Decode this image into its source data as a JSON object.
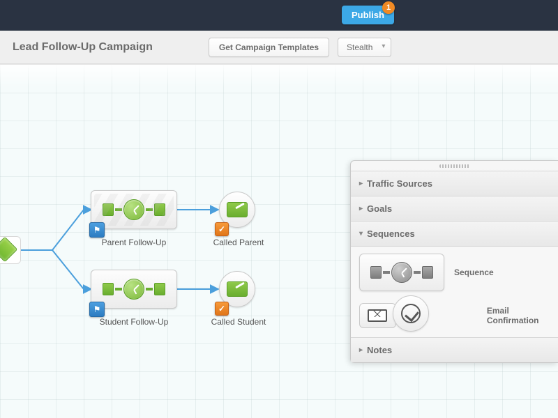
{
  "topbar": {
    "publish_label": "Publish",
    "publish_badge": "1"
  },
  "header": {
    "title": "Lead Follow-Up Campaign",
    "get_templates_label": "Get Campaign Templates",
    "mode_dropdown": "Stealth"
  },
  "canvas": {
    "nodes": {
      "seq1": {
        "label": "Parent Follow-Up"
      },
      "seq2": {
        "label": "Student Follow-Up"
      },
      "goal1": {
        "label": "Called Parent"
      },
      "goal2": {
        "label": "Called Student"
      }
    }
  },
  "panel": {
    "sections": {
      "traffic": "Traffic Sources",
      "goals": "Goals",
      "sequences": "Sequences",
      "notes": "Notes"
    },
    "items": {
      "sequence": "Sequence",
      "email_confirmation": "Email Confirmation"
    }
  }
}
